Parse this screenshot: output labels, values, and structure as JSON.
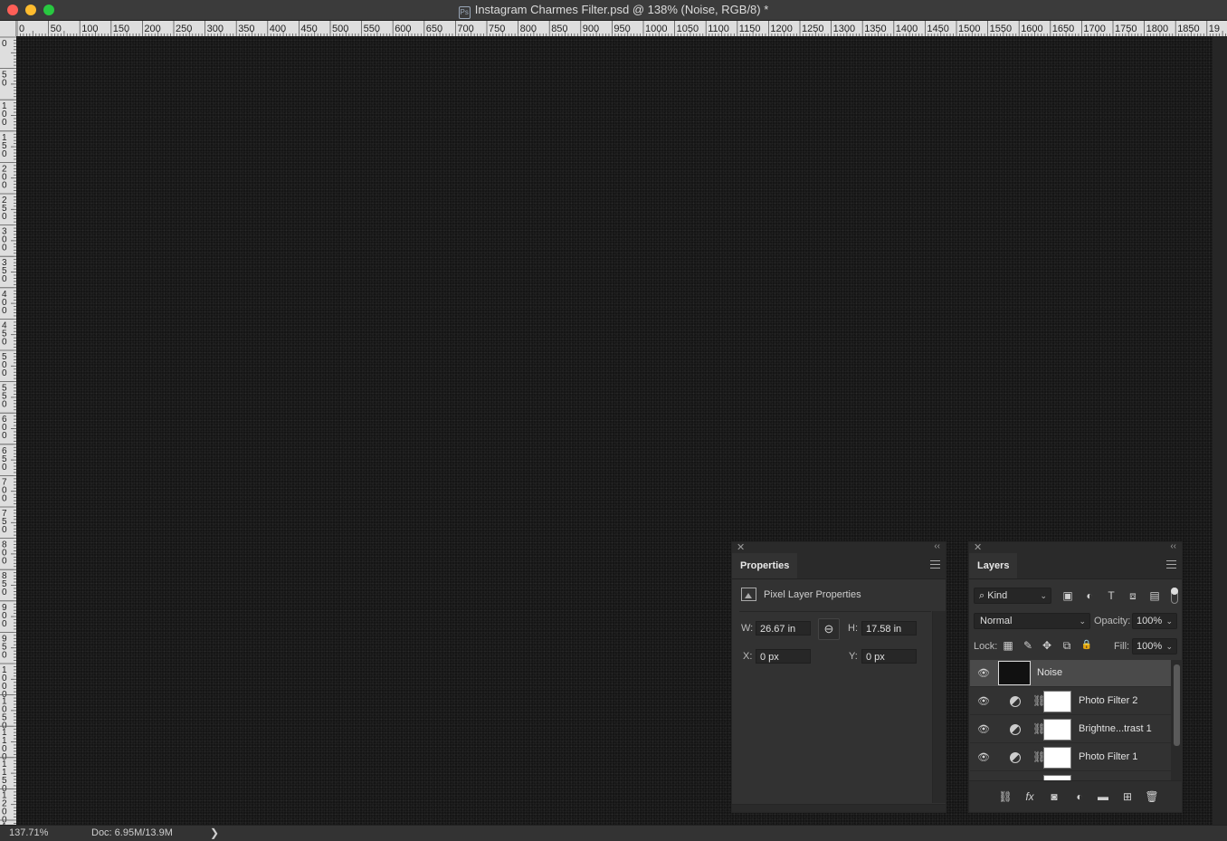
{
  "window": {
    "title": "Instagram Charmes Filter.psd @ 138% (Noise, RGB/8) *",
    "app_icon": "photoshop-doc-icon",
    "app_icon_text": "Ps"
  },
  "rulers": {
    "horizontal_labels": [
      "0",
      "50",
      "100",
      "150",
      "200",
      "250",
      "300",
      "350",
      "400",
      "450",
      "500",
      "550",
      "600",
      "650",
      "700",
      "750",
      "800",
      "850",
      "900",
      "950",
      "1000",
      "1050",
      "1100",
      "1150",
      "1200",
      "1250",
      "1300",
      "1350",
      "1400",
      "1450",
      "1500",
      "1550",
      "1600",
      "1650",
      "1700",
      "1750",
      "1800",
      "1850",
      "19"
    ],
    "vertical_labels": [
      "0",
      "50",
      "100",
      "150",
      "200",
      "250",
      "300",
      "350",
      "400",
      "450",
      "500",
      "550",
      "600",
      "650",
      "700",
      "750",
      "800",
      "850",
      "900",
      "950",
      "1000",
      "1050",
      "1100",
      "1150",
      "1200",
      "1250"
    ]
  },
  "status_bar": {
    "zoom": "137.71%",
    "doc_info": "Doc: 6.95M/13.9M",
    "arrow": "❯"
  },
  "properties_panel": {
    "close": "✕",
    "collapse": "‹‹",
    "tab": "Properties",
    "type_label": "Pixel Layer Properties",
    "w_label": "W:",
    "w_value": "26.67 in",
    "h_label": "H:",
    "h_value": "17.58 in",
    "x_label": "X:",
    "x_value": "0 px",
    "y_label": "Y:",
    "y_value": "0 px",
    "link_icon": "⊖"
  },
  "layers_panel": {
    "close": "✕",
    "collapse": "‹‹",
    "tab": "Layers",
    "filter_kind": "Kind",
    "filter_icons": [
      "image-filter-icon",
      "adjustment-filter-icon",
      "type-filter-icon",
      "shape-filter-icon",
      "smart-object-filter-icon"
    ],
    "filter_glyphs": [
      "▣",
      "◐",
      "T",
      "⧈",
      "▤"
    ],
    "blend_mode": "Normal",
    "opacity_label": "Opacity:",
    "opacity_value": "100%",
    "lock_label": "Lock:",
    "lock_glyphs": [
      "▦",
      "✎",
      "✥",
      "⧉",
      "🔒"
    ],
    "fill_label": "Fill:",
    "fill_value": "100%",
    "layers": [
      {
        "name": "Noise",
        "selected": true,
        "type": "pixel"
      },
      {
        "name": "Photo Filter 2",
        "selected": false,
        "type": "adjustment"
      },
      {
        "name": "Brightne...trast 1",
        "selected": false,
        "type": "adjustment"
      },
      {
        "name": "Photo Filter 1",
        "selected": false,
        "type": "adjustment"
      }
    ],
    "eye_glyph": "👁",
    "chain_glyph": "⛓",
    "footer_glyphs": [
      "⛓",
      "fx",
      "◙",
      "◐",
      "▬",
      "⊞",
      "🗑"
    ]
  },
  "colors": {
    "canvas": "#151515",
    "panel": "#323232",
    "selected_layer": "#4a4a4a",
    "ruler": "#dedede"
  }
}
